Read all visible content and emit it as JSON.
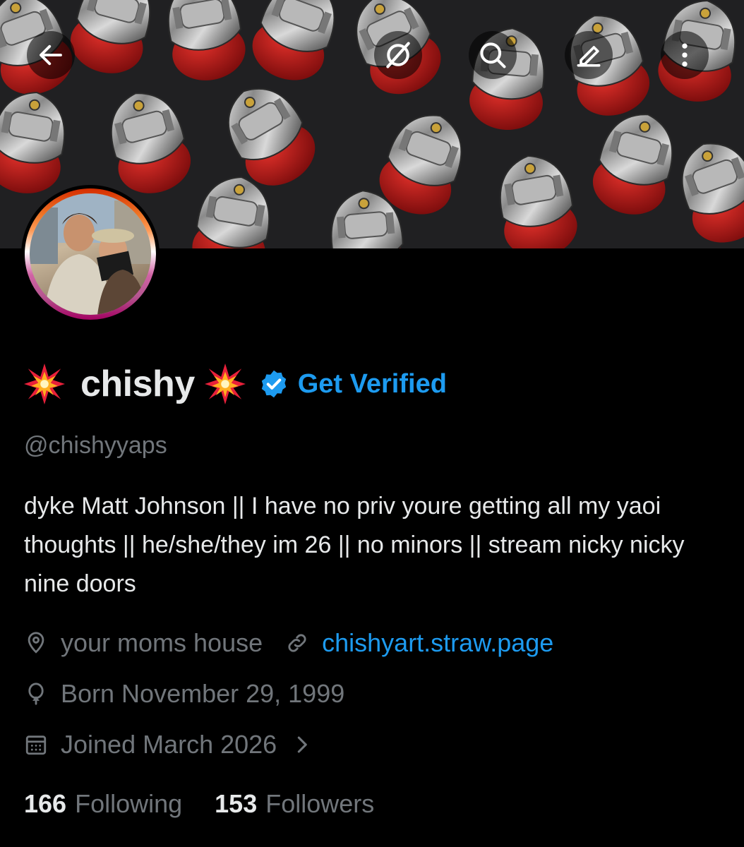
{
  "header": {
    "back_icon": "arrow-left-icon",
    "grok_icon": "grok-icon",
    "search_icon": "search-icon",
    "edit_icon": "edit-icon",
    "more_icon": "more-vertical-icon"
  },
  "profile": {
    "display_name": "chishy",
    "emoji_left": "💥",
    "emoji_right": "💥",
    "get_verified_label": "Get Verified",
    "handle": "@chishyyaps",
    "bio": "dyke Matt Johnson || I have no priv youre getting all my yaoi thoughts || he/she/they im 26 || no minors || stream nicky nicky nine doors",
    "location": "your moms house",
    "website": "chishyart.straw.page",
    "born": "Born November 29, 1999",
    "joined": "Joined March 2026",
    "following_count": "166",
    "following_label": "Following",
    "followers_count": "153",
    "followers_label": "Followers"
  },
  "colors": {
    "background": "#000000",
    "text_primary": "#e7e9ea",
    "text_secondary": "#71767b",
    "accent": "#1d9bf0"
  }
}
